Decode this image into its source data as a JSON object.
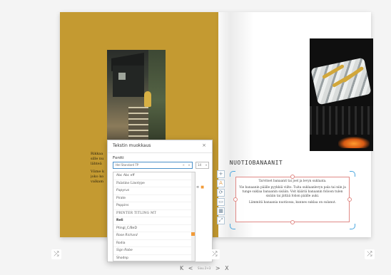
{
  "left_page": {
    "text_lines": [
      "Rikkaa",
      "sille nu",
      "lähteä",
      "",
      "Viime k",
      "joko ko",
      "valkam"
    ]
  },
  "right_page": {
    "title": "NUOTIOBANAANIT",
    "paragraphs": [
      "Tarvitset banaanit tai joel ja levyn suklaata.",
      "Vie banaanin päälle pyykkiä viilto. Tuita suklaanlevyn pala tai niin ja tunge suklaa banaanin sisään. Voit kääriä banaanin folioon tulen sisään tai jättää folion päälle auki.",
      "Lämmitä banaania nuotiossa, kunnes suklaa on sulanut."
    ]
  },
  "text_panel": {
    "title": "Tekstin muokkaus",
    "close_icon": "close-icon",
    "font_label": "Fontti",
    "font_value": "Hel Standard TP",
    "size_value": "14",
    "font_options": [
      "Abc Abc eff",
      "Palatino Linotype",
      "Papyrus",
      "Pirate",
      "Poppins",
      "PRINTER TITLING MT",
      "Reli",
      "Ptingl_C/BeD",
      "Rose Richard",
      "Rodia",
      "Sign Robe",
      "Shodnp"
    ]
  },
  "pager": {
    "first": "K",
    "prev": "<",
    "page_indicator": "Sivu 2+3",
    "next": ">",
    "last": "X"
  },
  "icons": {
    "shuffle": "shuffle-icon",
    "tool_items": [
      "plus-icon",
      "text-icon",
      "rotate-icon",
      "layer-icon",
      "image-icon",
      "expand-icon"
    ]
  },
  "colors": {
    "left_page": "#c49a31",
    "selection_border": "#e08a86",
    "corner_handles": "#4aa7df",
    "accent_orange": "#f29b38"
  }
}
